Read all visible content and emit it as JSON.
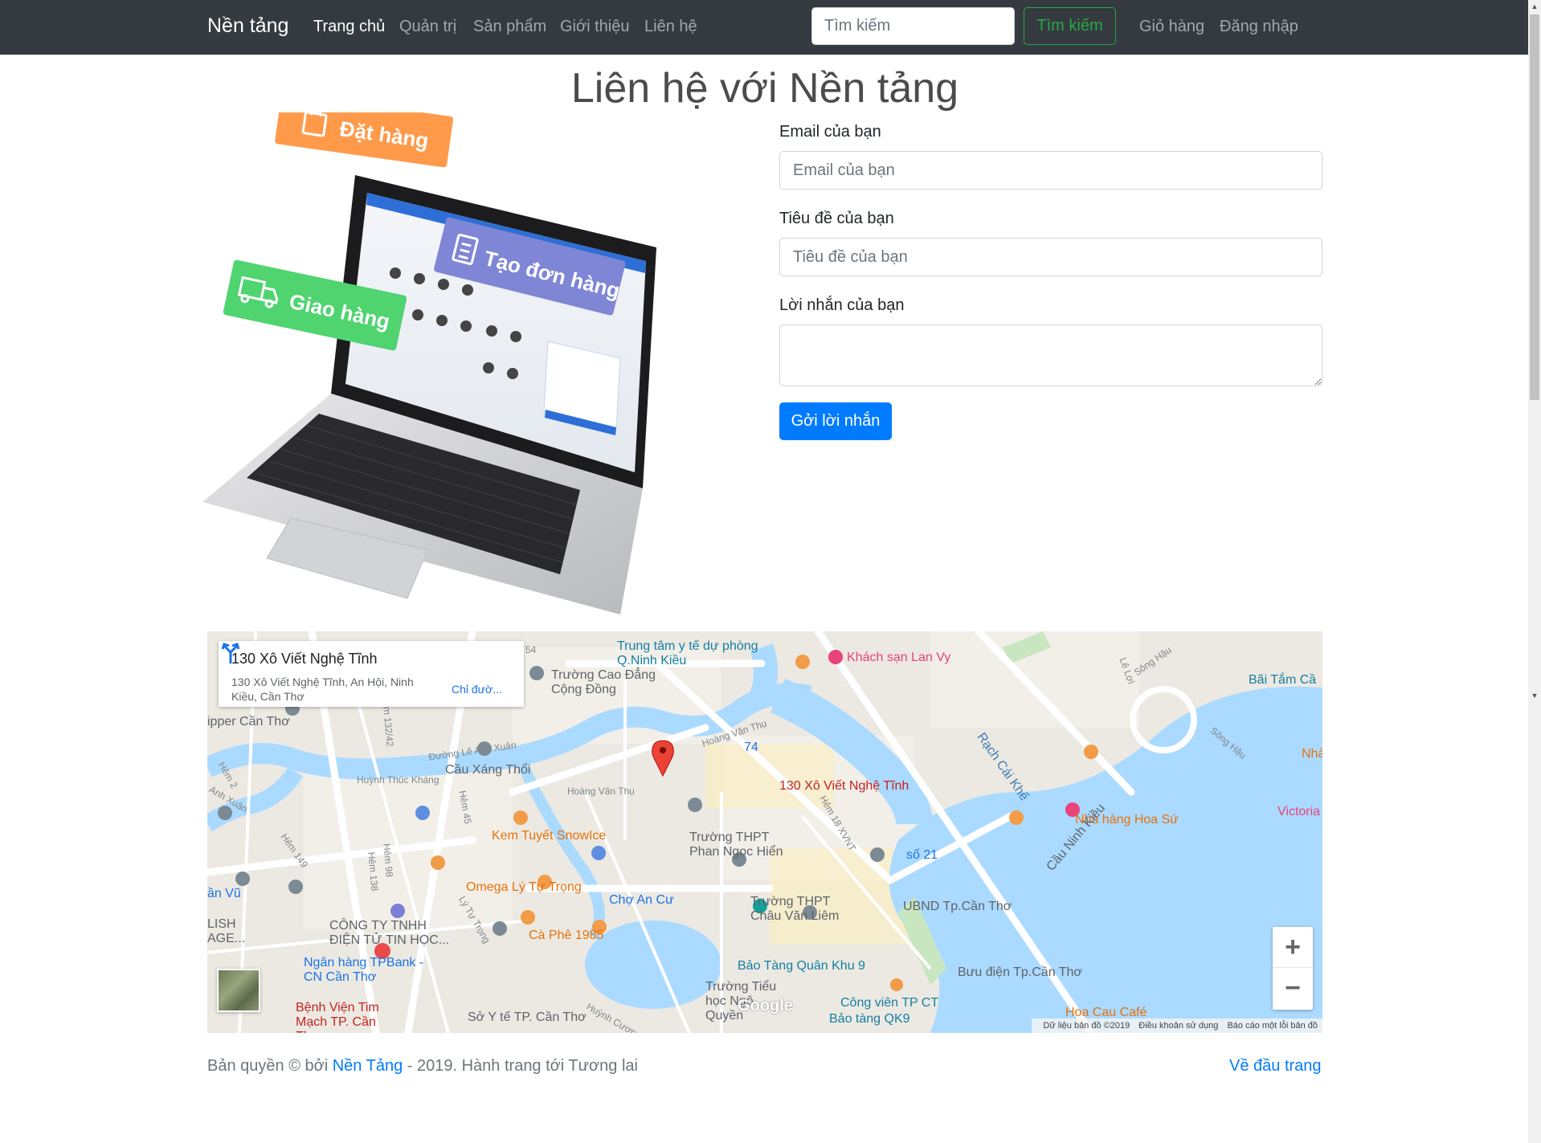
{
  "navbar": {
    "brand": "Nền tảng",
    "links": [
      "Trang chủ",
      "Quản trị",
      "Sản phẩm",
      "Giới thiệu",
      "Liên hệ"
    ],
    "search_placeholder": "Tìm kiếm",
    "search_button": "Tìm kiếm",
    "cart": "Giỏ hàng",
    "login": "Đăng nhập"
  },
  "page": {
    "title": "Liên hệ với Nền tảng"
  },
  "illustration": {
    "tag_order": "Đặt hàng",
    "tag_create": "Tạo đơn hàng",
    "tag_ship": "Giao hàng"
  },
  "form": {
    "email_label": "Email của bạn",
    "email_placeholder": "Email của bạn",
    "subject_label": "Tiêu đề của bạn",
    "subject_placeholder": "Tiêu đề của bạn",
    "message_label": "Lời nhắn của bạn",
    "submit": "Gởi lời nhắn"
  },
  "map": {
    "place_name": "130 Xô Viết Nghệ Tĩnh",
    "place_address": "130 Xô Viết Nghệ Tĩnh, An Hội, Ninh Kiều, Cần Thơ",
    "directions": "Chỉ đườ...",
    "marker_label": "130 Xô Viết Nghệ Tĩnh",
    "labels": {
      "trung_tam": "Trung tâm y tế dự phòng Q.Ninh Kiều",
      "truong_cao_dang": "Trường Cao Đẳng Cộng Đồng",
      "khach_san": "Khách sạn Lan Vy",
      "bai_tam": "Bãi Tắm Cầ",
      "shipper": "ipper Cần Thơ",
      "cau_xang_thoi": "Cầu Xáng Thổi",
      "so_74": "74",
      "rach_cai_khe": "Rạch Cái Khế",
      "nha_hang_hoa_su": "Nhà hàng Hoa Sứ",
      "victoria": "Victoria",
      "nha_right": "Nhà",
      "kem_tuyet": "Kem Tuyết SnowIce",
      "truong_phan_ngoc_hien": "Trường THPT Phan Ngọc Hiển",
      "so_21": "số 21",
      "cau_ninh_kieu": "Cầu Ninh Kiều",
      "omega": "Omega Lý Tự Trọng",
      "cho_an_cu": "Chợ An Cư",
      "truong_chau_van_liem": "Trường THPT Châu Văn Liêm",
      "ubnd": "UBND Tp.Cần Thơ",
      "an_vu": "ần Vũ",
      "lish": "LISH AGE...",
      "cong_ty": "CÔNG TY TNHH ĐIỆN TỬ TIN HỌC...",
      "ca_phe": "Cà Phê 1985",
      "ngan_hang": "Ngân hàng TPBank - CN Cần Thơ",
      "bao_tang_qk9": "Bảo Tàng Quân Khu 9",
      "buu_dien": "Bưu điện Tp.Cần Thơ",
      "benh_vien": "Bệnh Viện Tim Mạch TP. Cần Thơ",
      "so_y_te": "Sở Y tế TP. Cần Thơ",
      "truong_tieu_hoc": "Trường Tiểu học Ngô Quyền",
      "cong_vien": "Công viên TP CT",
      "bao_tang_qk9_short": "Bảo tàng QK9",
      "hoa_cau": "Hoa Cau Café",
      "duong_le_anh_xuan": "Đường Lê Anh Xuân",
      "huynh_thuc_khang": "Huỳnh Thúc Kháng",
      "hoang_van_thu": "Hoàng Văn Thụ",
      "hoang_van_thu_2": "Hoàng Văn Thụ",
      "hem_18": "Hẻm 18 XVNT",
      "hem_45": "Hẻm 45",
      "hem_149": "Hẻm 149",
      "hem_138": "Hẻm 138",
      "hem_98": "Hẻm 98",
      "hem_132": "Hẻm 132/42",
      "ly_tu_trong": "Lý Tự Trọng",
      "huynh_cuong": "Huỳnh Cương",
      "song_hau": "Sông Hậu",
      "song_hau_2": "Sông Hậu",
      "le_loi": "Lê Lợi",
      "hem_2": "Hẻm 2",
      "anh_xuan": "Anh Xuân",
      "hem_54": "54"
    },
    "zoom_in": "+",
    "zoom_out": "−",
    "google": "Google",
    "attribution": {
      "data": "Dữ liệu bản đồ ©2019",
      "terms": "Điều khoản sử dụng",
      "report": "Báo cáo một lỗi bản đồ"
    }
  },
  "footer": {
    "prefix": "Bản quyền © bởi",
    "link": "Nền Tảng",
    "suffix": "- 2019. Hành trang tới Tương lai",
    "back_to_top": "Về đầu trang"
  },
  "colors": {
    "navbar_bg": "#343a40",
    "primary": "#007bff",
    "success": "#28a745",
    "map_water": "#aadaff",
    "map_marker": "#ea4335"
  },
  "icons": [
    "search-icon",
    "map-marker-icon",
    "directions-icon",
    "restaurant-icon",
    "school-icon",
    "hotel-icon",
    "museum-icon",
    "shopping-icon",
    "hospital-icon",
    "bank-icon",
    "mail-icon",
    "bus-icon"
  ]
}
